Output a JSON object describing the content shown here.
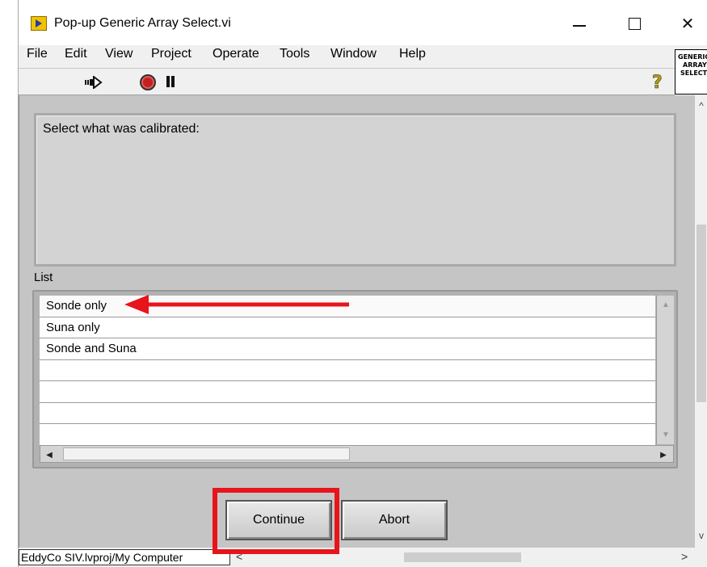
{
  "window": {
    "title": "Pop-up Generic Array Select.vi",
    "controls": {
      "minimize": "—",
      "maximize": "□",
      "close": "✕"
    }
  },
  "menu": [
    "File",
    "Edit",
    "View",
    "Project",
    "Operate",
    "Tools",
    "Window",
    "Help"
  ],
  "vi_icon_text": [
    "GENERIC",
    "ARRAY",
    "SELECT"
  ],
  "toolbar": {
    "run_icon": "run-arrow-icon",
    "abort_icon": "abort-execution-icon",
    "pause_icon": "pause-icon",
    "help_icon": "context-help-icon"
  },
  "panel": {
    "message": "Select what was calibrated:",
    "list_label": "List",
    "list_items": [
      "Sonde only",
      "Suna only",
      "Sonde and Suna",
      "",
      "",
      "",
      ""
    ],
    "buttons": {
      "continue": "Continue",
      "abort": "Abort"
    }
  },
  "status": {
    "path": "EddyCo SIV.lvproj/My Computer"
  },
  "colors": {
    "annotation_red": "#e8141b",
    "panel_bg": "#c5c5c5",
    "stop_red": "#c0211f"
  }
}
